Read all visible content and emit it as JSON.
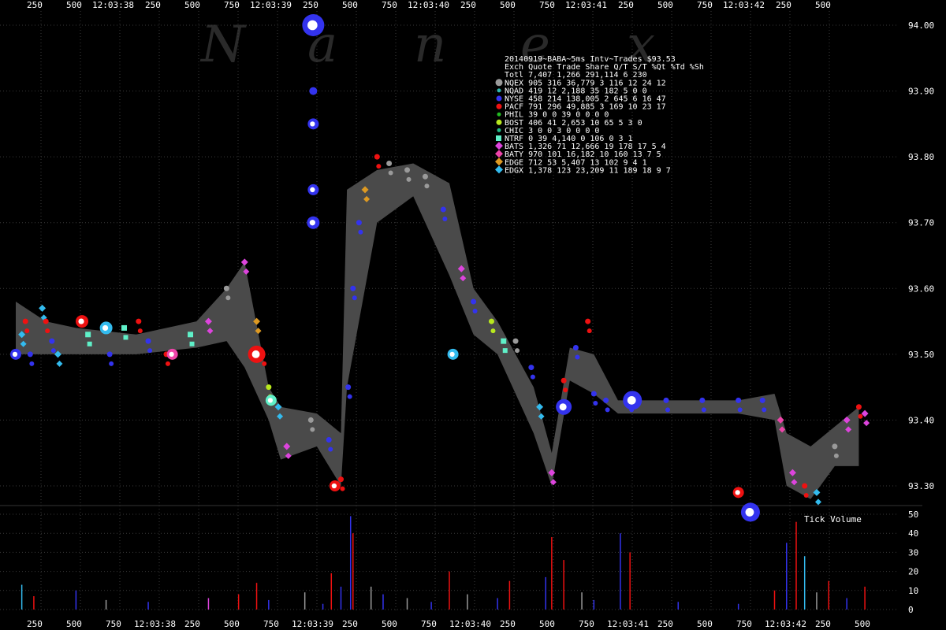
{
  "watermark": [
    "N",
    "a",
    "n",
    "e",
    "x"
  ],
  "legend": {
    "title": "20140919~BABA~5ms Intv~Trades $93.53",
    "header": "Exch Quote Trade    Share  Q/T   S/T  %Qt %Td %Sh",
    "total": "Totl 7,407 1,266 291,114    6   230",
    "rows": [
      {
        "text": "NQEX   905   316  36,779    3   116  12  24  12",
        "color": "#9a9a9a",
        "shape": "circle-large"
      },
      {
        "text": "NQAD   419    12   2,188   35   182   5   0   0",
        "color": "#2fb8b0",
        "shape": "circle-small"
      },
      {
        "text": "NYSE   458   214 138,005    2   645   6  16  47",
        "color": "#3333ee",
        "shape": "circle"
      },
      {
        "text": "PACF   791   296  49,885    3   169  10  23  17",
        "color": "#ee1111",
        "shape": "circle"
      },
      {
        "text": "PHIL    39     0       0   39     0   0   0   0",
        "color": "#22bb22",
        "shape": "circle-small"
      },
      {
        "text": "BOST   406    41   2,653   10    65   5   3   0",
        "color": "#b8e81e",
        "shape": "circle"
      },
      {
        "text": "CHIC     3     0       0    3     0   0   0   0",
        "color": "#22bb88",
        "shape": "circle-small"
      },
      {
        "text": "NTRF     0    39   4,140    0   106   0   3   1",
        "color": "#5ff0c8",
        "shape": "square"
      },
      {
        "text": "BATS 1,326    71  12,666   19   178  17   5   4",
        "color": "#dd44dd",
        "shape": "diamond"
      },
      {
        "text": "BATY   970   101  16,182   10   160  13   7   5",
        "color": "#ee44aa",
        "shape": "diamond"
      },
      {
        "text": "EDGE   712    53   5,407   13   102   9   4   1",
        "color": "#dd9922",
        "shape": "diamond"
      },
      {
        "text": "EDGX 1,378   123  23,209   11   189  18   9   7",
        "color": "#33bbee",
        "shape": "diamond"
      }
    ]
  },
  "volume_label": "Tick Volume",
  "chart_data": {
    "type": "scatter",
    "title": "20140919~BABA~5ms Intv~Trades $93.53",
    "price_axis": {
      "ticks": [
        "94.00",
        "93.90",
        "93.80",
        "93.70",
        "93.60",
        "93.50",
        "93.40",
        "93.30"
      ],
      "range": [
        93.26,
        94.02
      ]
    },
    "volume_axis": {
      "ticks": [
        "50",
        "40",
        "30",
        "20",
        "10",
        "0"
      ],
      "range": [
        0,
        52
      ]
    },
    "time_ticks_top": [
      "250",
      "500",
      "12:03:38",
      "250",
      "500",
      "750",
      "12:03:39",
      "250",
      "500",
      "750",
      "12:03:40",
      "250",
      "500",
      "750",
      "12:03:41",
      "250",
      "500",
      "750",
      "12:03:42",
      "250",
      "500"
    ],
    "time_ticks_bottom": [
      "250",
      "500",
      "750",
      "12:03:38",
      "250",
      "500",
      "750",
      "12:03:39",
      "250",
      "500",
      "750",
      "12:03:40",
      "250",
      "500",
      "750",
      "12:03:41",
      "250",
      "500",
      "750",
      "12:03:42",
      "250",
      "500"
    ],
    "nbbo_band": [
      [
        0.0,
        93.58,
        93.5
      ],
      [
        0.25,
        93.55,
        93.5
      ],
      [
        0.5,
        93.54,
        93.5
      ],
      [
        1.0,
        93.53,
        93.5
      ],
      [
        1.5,
        93.55,
        93.51
      ],
      [
        1.75,
        93.6,
        93.52
      ],
      [
        1.9,
        93.64,
        93.48
      ],
      [
        2.1,
        93.45,
        93.4
      ],
      [
        2.2,
        93.42,
        93.34
      ],
      [
        2.5,
        93.41,
        93.36
      ],
      [
        2.7,
        93.38,
        93.3
      ],
      [
        2.75,
        93.75,
        93.45
      ],
      [
        3.0,
        93.78,
        93.7
      ],
      [
        3.3,
        93.79,
        93.74
      ],
      [
        3.6,
        93.76,
        93.62
      ],
      [
        3.8,
        93.6,
        93.53
      ],
      [
        4.0,
        93.55,
        93.5
      ],
      [
        4.3,
        93.45,
        93.38
      ],
      [
        4.45,
        93.35,
        93.3
      ],
      [
        4.6,
        93.51,
        93.46
      ],
      [
        4.8,
        93.5,
        93.44
      ],
      [
        5.0,
        93.43,
        93.41
      ],
      [
        6.0,
        93.43,
        93.41
      ],
      [
        6.3,
        93.44,
        93.4
      ],
      [
        6.4,
        93.38,
        93.3
      ],
      [
        6.6,
        93.36,
        93.28
      ],
      [
        6.8,
        93.39,
        93.33
      ],
      [
        7.0,
        93.42,
        93.33
      ]
    ],
    "trades": [
      [
        0.05,
        93.53,
        "EDGX"
      ],
      [
        0.08,
        93.55,
        "PACF"
      ],
      [
        0.12,
        93.5,
        "NYSE"
      ],
      [
        0.22,
        93.57,
        "EDGX"
      ],
      [
        0.25,
        93.55,
        "PACF"
      ],
      [
        0.3,
        93.52,
        "NYSE"
      ],
      [
        0.35,
        93.5,
        "EDGX"
      ],
      [
        0.6,
        93.53,
        "NTRF"
      ],
      [
        0.78,
        93.5,
        "NYSE"
      ],
      [
        0.9,
        93.54,
        "NTRF"
      ],
      [
        1.02,
        93.55,
        "PACF"
      ],
      [
        1.1,
        93.52,
        "NYSE"
      ],
      [
        1.25,
        93.5,
        "PACF"
      ],
      [
        1.45,
        93.53,
        "NTRF"
      ],
      [
        1.6,
        93.55,
        "BATS"
      ],
      [
        1.75,
        93.6,
        "NQEX"
      ],
      [
        1.9,
        93.64,
        "BATS"
      ],
      [
        2.0,
        93.55,
        "EDGE"
      ],
      [
        2.05,
        93.5,
        "PACF"
      ],
      [
        2.1,
        93.45,
        "BOST"
      ],
      [
        2.18,
        93.42,
        "EDGX"
      ],
      [
        2.25,
        93.36,
        "BATS"
      ],
      [
        2.45,
        93.4,
        "NQEX"
      ],
      [
        2.6,
        93.37,
        "NYSE"
      ],
      [
        2.7,
        93.31,
        "PACF"
      ],
      [
        2.76,
        93.45,
        "NYSE"
      ],
      [
        2.8,
        93.6,
        "NYSE"
      ],
      [
        2.85,
        93.7,
        "NYSE"
      ],
      [
        2.9,
        93.75,
        "EDGE"
      ],
      [
        3.0,
        93.8,
        "PACF"
      ],
      [
        3.1,
        93.79,
        "NQEX"
      ],
      [
        3.25,
        93.78,
        "NQEX"
      ],
      [
        3.4,
        93.77,
        "NQEX"
      ],
      [
        3.55,
        93.72,
        "NYSE"
      ],
      [
        3.7,
        93.63,
        "BATS"
      ],
      [
        3.8,
        93.58,
        "NYSE"
      ],
      [
        3.95,
        93.55,
        "BOST"
      ],
      [
        4.05,
        93.52,
        "NTRF"
      ],
      [
        4.15,
        93.52,
        "NQEX"
      ],
      [
        4.28,
        93.48,
        "NYSE"
      ],
      [
        4.35,
        93.42,
        "EDGX"
      ],
      [
        4.45,
        93.32,
        "BATS"
      ],
      [
        4.55,
        93.46,
        "PACF"
      ],
      [
        4.65,
        93.51,
        "NYSE"
      ],
      [
        4.75,
        93.55,
        "PACF"
      ],
      [
        4.8,
        93.44,
        "NYSE"
      ],
      [
        4.9,
        93.43,
        "NYSE"
      ],
      [
        5.1,
        93.43,
        "NYSE"
      ],
      [
        5.4,
        93.43,
        "NYSE"
      ],
      [
        5.7,
        93.43,
        "NYSE"
      ],
      [
        6.0,
        93.43,
        "NYSE"
      ],
      [
        6.2,
        93.43,
        "NYSE"
      ],
      [
        6.35,
        93.4,
        "BATY"
      ],
      [
        6.45,
        93.32,
        "BATS"
      ],
      [
        6.55,
        93.3,
        "PACF"
      ],
      [
        6.65,
        93.29,
        "EDGX"
      ],
      [
        6.8,
        93.36,
        "NQEX"
      ],
      [
        6.9,
        93.4,
        "BATS"
      ],
      [
        7.0,
        93.42,
        "PACF"
      ],
      [
        7.05,
        93.41,
        "BATS"
      ]
    ],
    "large_trades": [
      [
        0.0,
        93.5,
        "NYSE",
        7
      ],
      [
        0.55,
        93.55,
        "PACF",
        8
      ],
      [
        0.75,
        93.54,
        "EDGX",
        8
      ],
      [
        1.3,
        93.5,
        "BATY",
        7
      ],
      [
        2.0,
        93.5,
        "PACF",
        11
      ],
      [
        2.12,
        93.43,
        "NTRF",
        7
      ],
      [
        2.65,
        93.3,
        "PACF",
        7
      ],
      [
        2.47,
        94.0,
        "NYSE",
        14
      ],
      [
        2.47,
        93.9,
        "NYSE",
        5
      ],
      [
        2.47,
        93.85,
        "NYSE",
        7
      ],
      [
        2.47,
        93.75,
        "NYSE",
        7
      ],
      [
        2.47,
        93.7,
        "NYSE",
        8
      ],
      [
        3.63,
        93.5,
        "EDGX",
        7
      ],
      [
        4.55,
        93.42,
        "NYSE",
        10
      ],
      [
        5.12,
        93.43,
        "NYSE",
        12
      ],
      [
        6.1,
        93.26,
        "NYSE",
        12
      ],
      [
        6.0,
        93.29,
        "PACF",
        7
      ]
    ],
    "volume_spikes": [
      [
        0.05,
        13,
        "EDGX"
      ],
      [
        0.15,
        7,
        "PACF"
      ],
      [
        0.5,
        10,
        "NYSE"
      ],
      [
        0.75,
        5,
        "NQEX"
      ],
      [
        1.1,
        4,
        "NYSE"
      ],
      [
        1.6,
        6,
        "BATS"
      ],
      [
        1.85,
        8,
        "PACF"
      ],
      [
        2.0,
        14,
        "PACF"
      ],
      [
        2.1,
        5,
        "NYSE"
      ],
      [
        2.4,
        9,
        "NQEX"
      ],
      [
        2.55,
        3,
        "NYSE"
      ],
      [
        2.62,
        19,
        "PACF"
      ],
      [
        2.7,
        12,
        "NYSE"
      ],
      [
        2.78,
        49,
        "NYSE"
      ],
      [
        2.8,
        40,
        "PACF"
      ],
      [
        2.95,
        12,
        "NQEX"
      ],
      [
        3.05,
        8,
        "NYSE"
      ],
      [
        3.25,
        6,
        "NQEX"
      ],
      [
        3.45,
        4,
        "NYSE"
      ],
      [
        3.6,
        20,
        "PACF"
      ],
      [
        3.75,
        8,
        "NQEX"
      ],
      [
        4.0,
        6,
        "NYSE"
      ],
      [
        4.1,
        15,
        "PACF"
      ],
      [
        4.4,
        17,
        "NYSE"
      ],
      [
        4.45,
        38,
        "PACF"
      ],
      [
        4.55,
        26,
        "PACF"
      ],
      [
        4.7,
        9,
        "NQEX"
      ],
      [
        4.8,
        5,
        "NYSE"
      ],
      [
        5.02,
        40,
        "NYSE"
      ],
      [
        5.1,
        30,
        "PACF"
      ],
      [
        5.5,
        4,
        "NYSE"
      ],
      [
        6.0,
        3,
        "NYSE"
      ],
      [
        6.3,
        10,
        "PACF"
      ],
      [
        6.4,
        35,
        "NYSE"
      ],
      [
        6.48,
        46,
        "PACF"
      ],
      [
        6.55,
        28,
        "EDGX"
      ],
      [
        6.65,
        9,
        "NQEX"
      ],
      [
        6.75,
        15,
        "PACF"
      ],
      [
        6.9,
        6,
        "NYSE"
      ],
      [
        7.05,
        12,
        "PACF"
      ]
    ]
  }
}
